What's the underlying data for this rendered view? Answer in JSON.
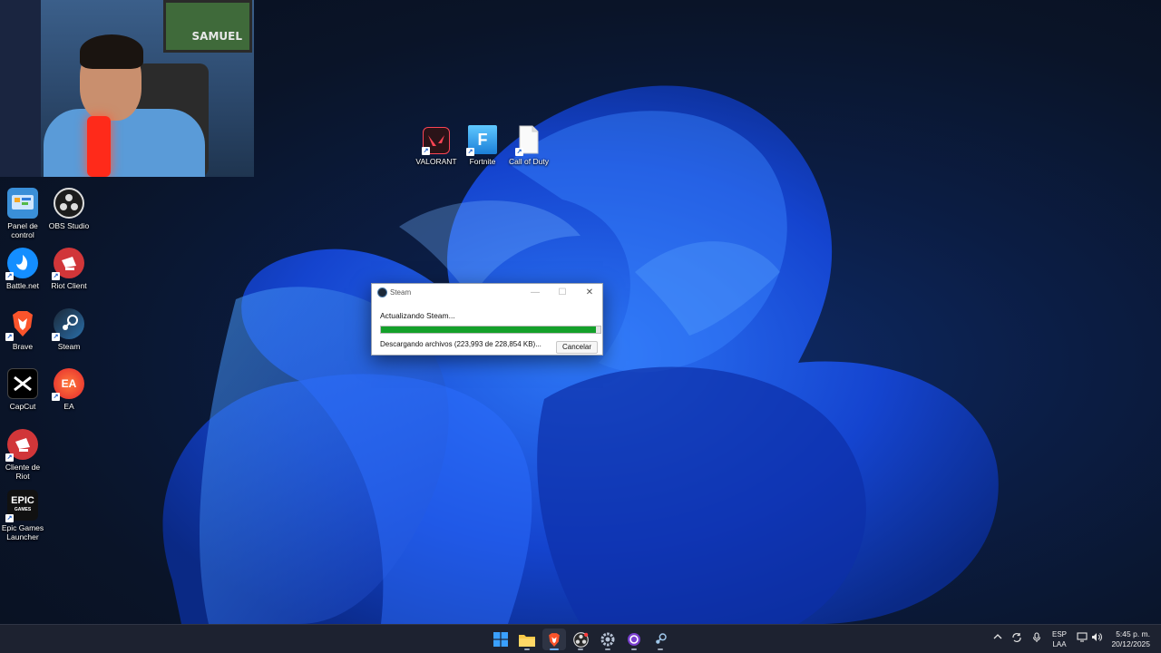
{
  "webcam": {
    "poster_text": "SAMUEL"
  },
  "desktop_icons_left": [
    {
      "label": "Panel de control",
      "icon": "control-panel-icon",
      "color": "#3a8fd8"
    },
    {
      "label": "OBS Studio",
      "icon": "obs-icon",
      "color": "#1c1c1c"
    },
    {
      "label": "Battle.net",
      "icon": "battlenet-icon",
      "color": "#148eff"
    },
    {
      "label": "Riot Client",
      "icon": "riot-icon",
      "color": "#d13639"
    },
    {
      "label": "Brave",
      "icon": "brave-icon",
      "color": "#fb542b"
    },
    {
      "label": "Steam",
      "icon": "steam-icon",
      "color": "#1b2838"
    },
    {
      "label": "CapCut",
      "icon": "capcut-icon",
      "color": "#000000"
    },
    {
      "label": "EA",
      "icon": "ea-icon",
      "color": "#ff4747"
    },
    {
      "label": "Cliente de Riot",
      "icon": "riot-icon",
      "color": "#d13639"
    },
    {
      "label": "Epic Games Launcher",
      "icon": "epic-icon",
      "color": "#111111"
    }
  ],
  "desktop_icons_center": [
    {
      "label": "VALORANT",
      "icon": "valorant-icon",
      "color": "#fa4454"
    },
    {
      "label": "Fortnite",
      "icon": "fortnite-icon",
      "color": "#2a9df4"
    },
    {
      "label": "Call of Duty",
      "icon": "file-icon",
      "color": "#ffffff"
    }
  ],
  "steam_dialog": {
    "title": "Steam",
    "message": "Actualizando Steam...",
    "progress": 0.98,
    "status": "Descargando archivos (223,993 de 228,854 KB)...",
    "cancel_label": "Cancelar",
    "minimize": "—",
    "maximize": "☐",
    "close": "✕"
  },
  "taskbar": {
    "apps": [
      {
        "icon": "windows-start-icon",
        "running": false
      },
      {
        "icon": "file-explorer-icon",
        "running": true
      },
      {
        "icon": "brave-icon",
        "running": true
      },
      {
        "icon": "obs-icon",
        "running": true
      },
      {
        "icon": "settings-icon",
        "running": true
      },
      {
        "icon": "circle-app-icon",
        "running": true
      },
      {
        "icon": "steam-icon",
        "running": true
      }
    ],
    "language_top": "ESP",
    "language_bottom": "LAA",
    "time": "5:45 p. m.",
    "date": "20/12/2025"
  }
}
